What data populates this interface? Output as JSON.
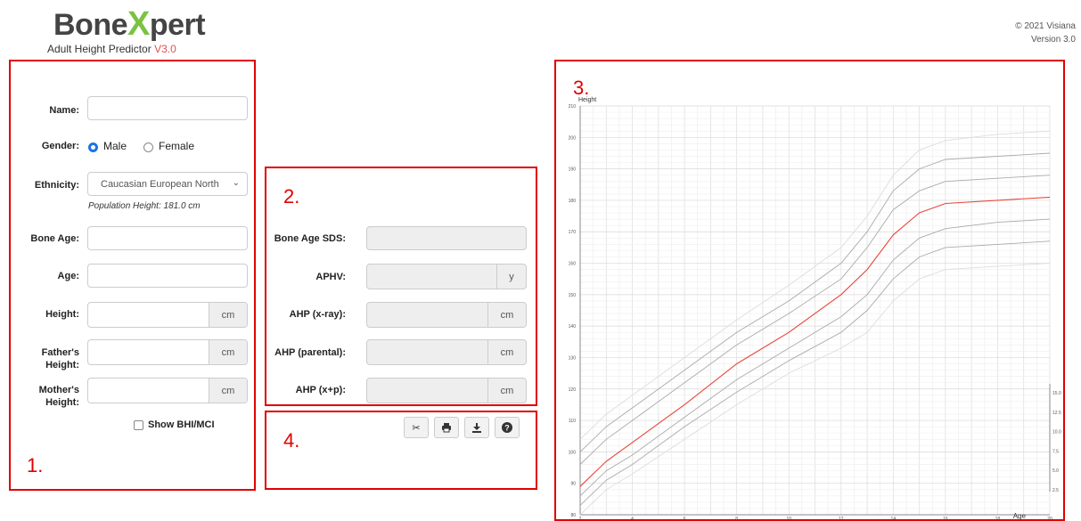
{
  "header": {
    "logo_part1": "Bone",
    "logo_x": "X",
    "logo_part2": "pert",
    "subtitle": "Adult Height Predictor ",
    "subtitle_version": "V3.0",
    "copyright": "© 2021 Visiana",
    "version": "Version 3.0"
  },
  "markers": {
    "one": "1.",
    "two": "2.",
    "three": "3.",
    "four": "4."
  },
  "form": {
    "name_label": "Name:",
    "name_value": "",
    "gender_label": "Gender:",
    "gender_options": [
      "Male",
      "Female"
    ],
    "gender_selected": "Male",
    "ethnicity_label": "Ethnicity:",
    "ethnicity_value": "Caucasian European North",
    "population_height": "Population Height: 181.0 cm",
    "bone_age_label": "Bone Age:",
    "age_label": "Age:",
    "height_label": "Height:",
    "father_label_1": "Father's",
    "father_label_2": "Height:",
    "mother_label_1": "Mother's",
    "mother_label_2": "Height:",
    "unit_cm": "cm",
    "show_bhi": "Show BHI/MCI"
  },
  "results": {
    "bone_age_sds_label": "Bone Age SDS:",
    "aphv_label": "APHV:",
    "aphv_unit": "y",
    "ahp_xray_label": "AHP (x-ray):",
    "ahp_parental_label": "AHP (parental):",
    "ahp_xp_label": "AHP (x+p):",
    "unit_cm": "cm"
  },
  "toolbar": {
    "icons": [
      "scissors-icon",
      "print-icon",
      "download-icon",
      "help-icon"
    ]
  },
  "colors": {
    "marker": "#e00000",
    "median_curve": "#e8463c",
    "accent": "#1a73e8"
  },
  "chart_data": {
    "type": "line",
    "ylabel": "Height",
    "xlabel": "Age",
    "xlim": [
      2,
      20
    ],
    "ylim": [
      80,
      210
    ],
    "x_ticks": [
      2,
      4,
      6,
      8,
      10,
      12,
      14,
      16,
      18,
      20
    ],
    "y_ticks": [
      80,
      90,
      100,
      110,
      120,
      130,
      140,
      150,
      160,
      170,
      180,
      190,
      200,
      210
    ],
    "secondary_y_ticks": [
      "2.5",
      "5.0",
      "7.5",
      "10.0",
      "12.5",
      "15.0"
    ],
    "grid": true,
    "x": [
      2,
      3,
      4,
      6,
      8,
      10,
      12,
      13,
      14,
      15,
      16,
      18,
      20
    ],
    "series": [
      {
        "values": [
          104,
          112,
          118,
          130,
          142,
          153,
          165,
          175,
          188,
          196,
          199,
          201,
          202
        ],
        "color": "#dddddd"
      },
      {
        "values": [
          100,
          108,
          114,
          126,
          138,
          148,
          160,
          170,
          183,
          190,
          193,
          194,
          195
        ],
        "color": "#aaaaaa"
      },
      {
        "values": [
          96,
          104,
          110,
          122,
          134,
          144,
          155,
          165,
          177,
          183,
          186,
          187,
          188
        ],
        "color": "#aaaaaa"
      },
      {
        "values": [
          89,
          97,
          103,
          115,
          128,
          138,
          150,
          158,
          169,
          176,
          179,
          180,
          181
        ],
        "color": "#e8463c"
      },
      {
        "values": [
          86,
          94,
          99,
          111,
          123,
          133,
          143,
          150,
          161,
          168,
          171,
          173,
          174
        ],
        "color": "#aaaaaa"
      },
      {
        "values": [
          83,
          91,
          96,
          108,
          119,
          129,
          138,
          145,
          155,
          162,
          165,
          166,
          167
        ],
        "color": "#aaaaaa"
      },
      {
        "values": [
          80,
          88,
          93,
          104,
          115,
          125,
          133,
          138,
          148,
          155,
          158,
          159,
          160
        ],
        "color": "#dddddd"
      }
    ]
  }
}
